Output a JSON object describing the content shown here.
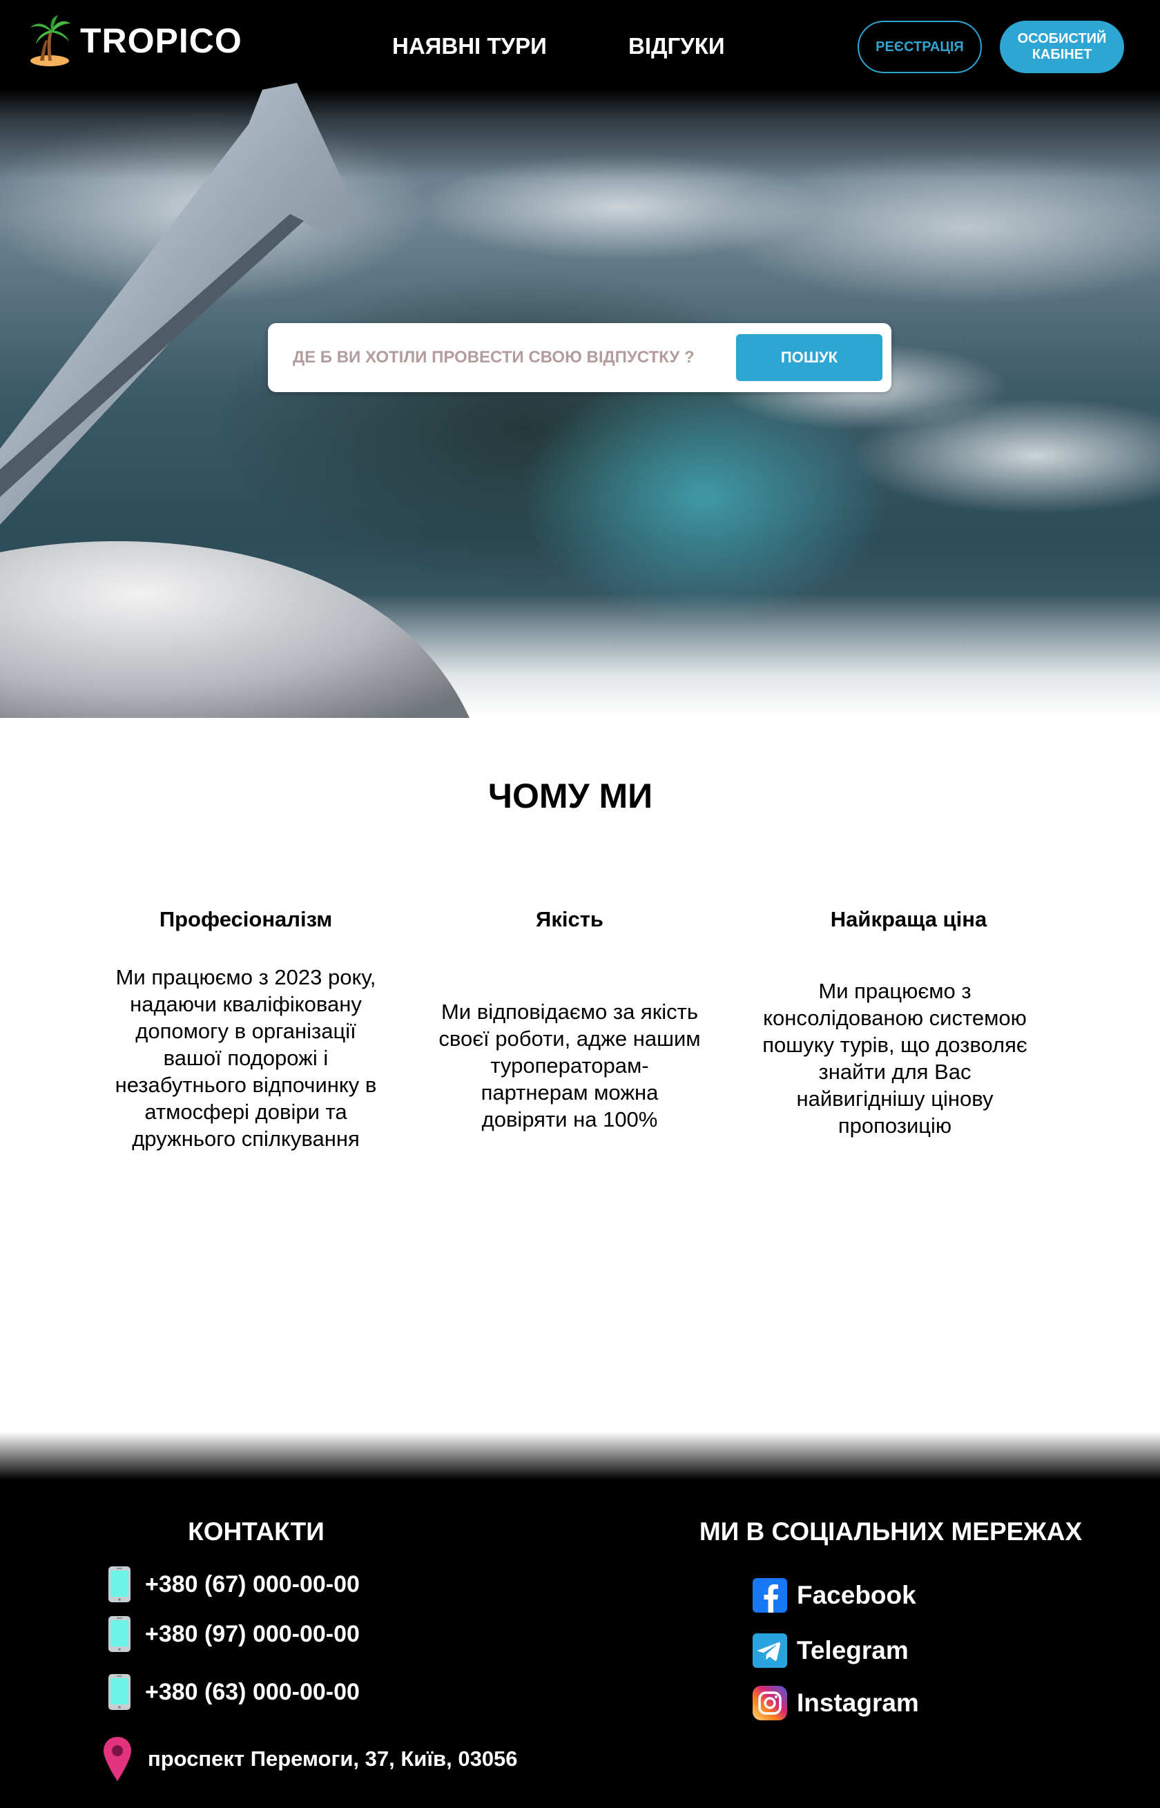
{
  "header": {
    "brand": "TROPICO",
    "logo_icon": "palm-tree-icon",
    "nav": [
      {
        "label": "НАЯВНІ ТУРИ"
      },
      {
        "label": "ВІДГУКИ"
      }
    ],
    "register_label": "РЕЄСТРАЦІЯ",
    "cabinet_label_line1": "ОСОБИСТИЙ",
    "cabinet_label_line2": "КАБІНЕТ"
  },
  "search": {
    "placeholder": "ДЕ Б ВИ ХОТІЛИ ПРОВЕСТИ СВОЮ ВІДПУСТКУ ?",
    "value": "",
    "button_label": "ПОШУК"
  },
  "why": {
    "title": "ЧОМУ МИ",
    "features": [
      {
        "title": "Професіоналізм",
        "lines": [
          "Ми працюємо з 2023 року,",
          "надаючи кваліфіковану",
          "допомогу в організації",
          "вашої подорожі і",
          "незабутнього відпочинку в",
          "атмосфері довіри та",
          "дружнього спілкування"
        ]
      },
      {
        "title": "Якість",
        "lines": [
          "Ми відповідаємо за якість",
          "своєї роботи, адже нашим",
          "туроператорам-",
          "партнерам можна",
          "довіряти на 100%"
        ]
      },
      {
        "title": "Найкраща ціна",
        "lines": [
          "Ми працюємо з",
          "консолідованою системою",
          "пошуку турів, що дозволяє",
          "знайти для Вас",
          "найвигіднішу цінову",
          "пропозицію"
        ]
      }
    ]
  },
  "footer": {
    "contacts_title": "КОНТАКТИ",
    "phones": [
      "+380 (67) 000-00-00",
      "+380 (97) 000-00-00",
      "+380 (63) 000-00-00"
    ],
    "address": "проспект Перемоги, 37, Київ, 03056",
    "social_title": "МИ В СОЦІАЛЬНИХ МЕРЕЖАХ",
    "socials": [
      {
        "label": "Facebook",
        "icon": "facebook-icon"
      },
      {
        "label": "Telegram",
        "icon": "telegram-icon"
      },
      {
        "label": "Instagram",
        "icon": "instagram-icon"
      }
    ]
  },
  "colors": {
    "accent": "#2ea6d3",
    "header_bg": "#000000",
    "footer_bg": "#000000",
    "placeholder": "#b39c9c",
    "pin": "#e2337e"
  }
}
